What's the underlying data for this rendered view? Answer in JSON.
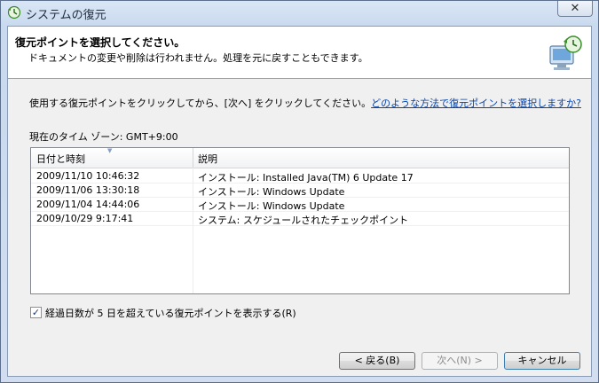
{
  "window": {
    "title": "システムの復元",
    "close_glyph": "✕"
  },
  "header": {
    "title": "復元ポイントを選択してください。",
    "subtitle": "ドキュメントの変更や削除は行われません。処理を元に戻すこともできます。"
  },
  "instruction": {
    "text": "使用する復元ポイントをクリックしてから、[次へ] をクリックしてください。",
    "link": "どのような方法で復元ポイントを選択しますか?"
  },
  "timezone": "現在のタイム ゾーン: GMT+9:00",
  "table": {
    "columns": [
      "日付と時刻",
      "説明"
    ],
    "rows": [
      {
        "date": "2009/11/10 10:46:32",
        "desc": "インストール: Installed Java(TM) 6 Update 17"
      },
      {
        "date": "2009/11/06 13:30:18",
        "desc": "インストール: Windows Update"
      },
      {
        "date": "2009/11/04 14:44:06",
        "desc": "インストール: Windows Update"
      },
      {
        "date": "2009/10/29 9:17:41",
        "desc": "システム: スケジュールされたチェックポイント"
      }
    ]
  },
  "show_more": {
    "label": "経過日数が 5 日を超えている復元ポイントを表示する(R)",
    "checked": true,
    "check_glyph": "✓"
  },
  "buttons": {
    "back": "< 戻る(B)",
    "next": "次へ(N) >",
    "cancel": "キャンセル"
  }
}
